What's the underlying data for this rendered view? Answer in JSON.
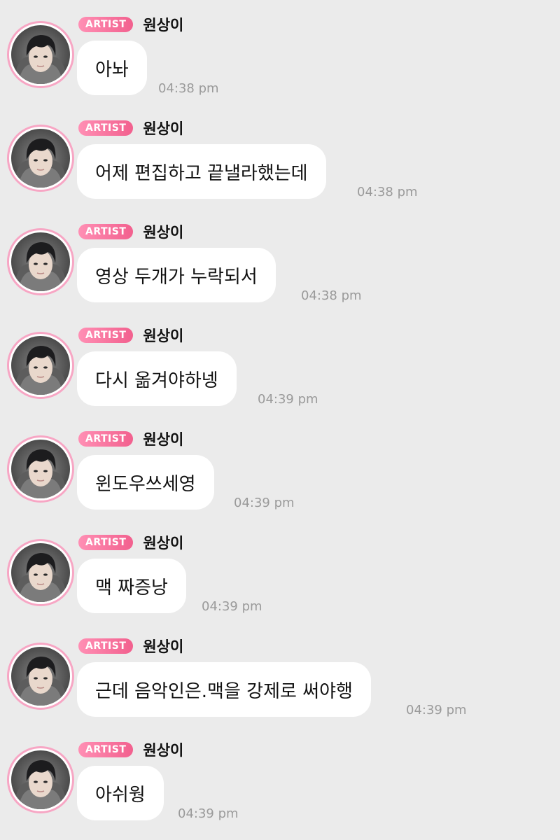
{
  "badge_label": "ARTIST",
  "colors": {
    "background": "#ebebeb",
    "badge": "#f2608e",
    "avatar_ring": "#f7a6c4",
    "bubble": "#ffffff",
    "timestamp": "#9a9a9a"
  },
  "avatar_icon": "profile-photo",
  "messages": [
    {
      "sender": "원상이",
      "badge": "ARTIST",
      "text": "아놔",
      "time": "04:38 pm"
    },
    {
      "sender": "원상이",
      "badge": "ARTIST",
      "text": "어제 편집하고 끝낼라했는데",
      "time": "04:38 pm"
    },
    {
      "sender": "원상이",
      "badge": "ARTIST",
      "text": "영상 두개가 누락되서",
      "time": "04:38 pm"
    },
    {
      "sender": "원상이",
      "badge": "ARTIST",
      "text": "다시 옮겨야하넹",
      "time": "04:39 pm"
    },
    {
      "sender": "원상이",
      "badge": "ARTIST",
      "text": "윈도우쓰세영",
      "time": "04:39 pm"
    },
    {
      "sender": "원상이",
      "badge": "ARTIST",
      "text": "맥 짜증낭",
      "time": "04:39 pm"
    },
    {
      "sender": "원상이",
      "badge": "ARTIST",
      "text": "근데 음악인은.맥을 강제로 써야행",
      "time": "04:39 pm"
    },
    {
      "sender": "원상이",
      "badge": "ARTIST",
      "text": "아쉬웡",
      "time": "04:39 pm"
    }
  ]
}
